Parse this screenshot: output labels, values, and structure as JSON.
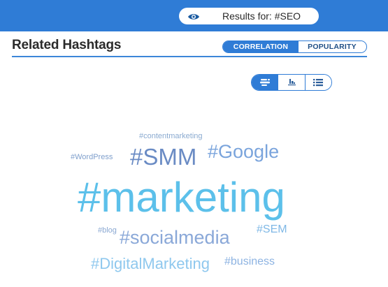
{
  "search": {
    "label": "Results for: #SEO"
  },
  "header": {
    "title": "Related Hashtags"
  },
  "sort_toggle": {
    "options": [
      "CORRELATION",
      "POPULARITY"
    ],
    "selected": "CORRELATION"
  },
  "view_toggle": {
    "options": [
      "cloud-view-icon",
      "chart-view-icon",
      "list-view-icon"
    ],
    "selected": "cloud-view-icon"
  },
  "word_cloud": {
    "tags": [
      "#contentmarketing",
      "#WordPress",
      "#SMM",
      "#Google",
      "#marketing",
      "#blog",
      "#socialmedia",
      "#SEM",
      "#DigitalMarketing",
      "#business"
    ]
  },
  "colors": {
    "accent": "#2f7cd6",
    "title_text": "#2b2b2b",
    "tag_primary": "#5cc0ea"
  }
}
